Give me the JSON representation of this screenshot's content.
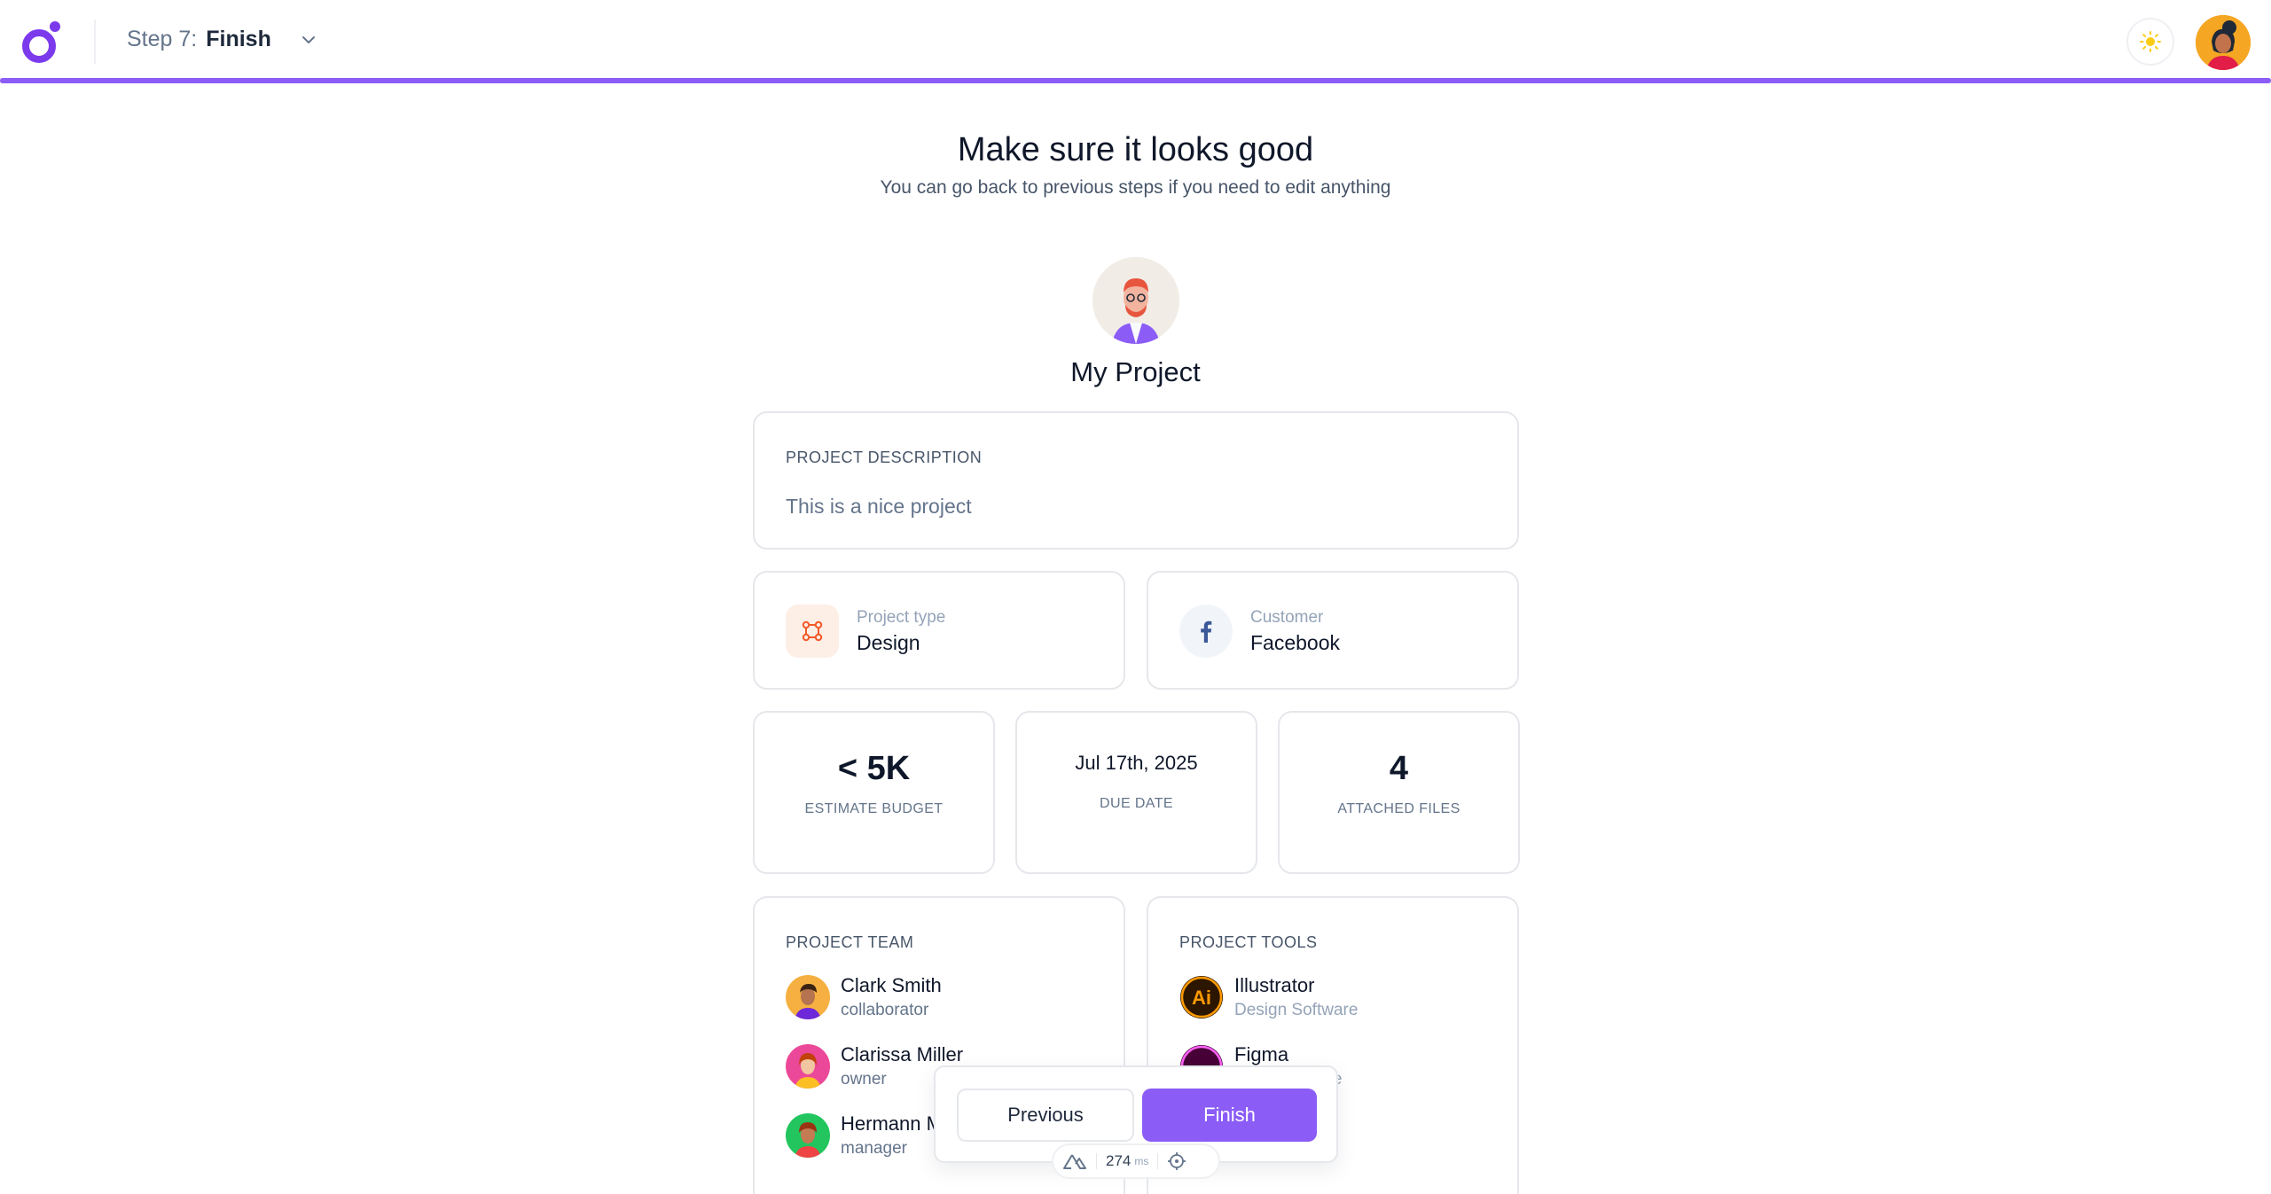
{
  "topbar": {
    "step_prefix": "Step 7:",
    "step_name": "Finish",
    "progress_percent": 100,
    "theme_icon": "sun-icon",
    "accent_color": "#8b5cf6"
  },
  "header": {
    "title": "Make sure it looks good",
    "subtitle": "You can go back to previous steps if you need to edit anything"
  },
  "project": {
    "name": "My Project",
    "description_label": "PROJECT DESCRIPTION",
    "description": "This is a nice project",
    "type_label": "Project type",
    "type_value": "Design",
    "customer_label": "Customer",
    "customer_value": "Facebook"
  },
  "stats": {
    "budget_value": "< 5K",
    "budget_label": "ESTIMATE BUDGET",
    "due_date_value": "Jul 17th, 2025",
    "due_date_label": "DUE DATE",
    "files_value": "4",
    "files_label": "ATTACHED FILES"
  },
  "team": {
    "label": "PROJECT TEAM",
    "members": [
      {
        "name": "Clark Smith",
        "role": "collaborator"
      },
      {
        "name": "Clarissa Miller",
        "role": "owner"
      },
      {
        "name": "Hermann M",
        "role": "manager"
      }
    ]
  },
  "tools": {
    "label": "PROJECT TOOLS",
    "items": [
      {
        "name": "Illustrator",
        "category": "Design Software",
        "icon": "illustrator-icon"
      },
      {
        "name": "Figma",
        "category": "are",
        "icon": "figma-icon"
      }
    ]
  },
  "actions": {
    "previous_label": "Previous",
    "finish_label": "Finish"
  },
  "devbar": {
    "ms_value": "274",
    "ms_unit": "ms"
  }
}
